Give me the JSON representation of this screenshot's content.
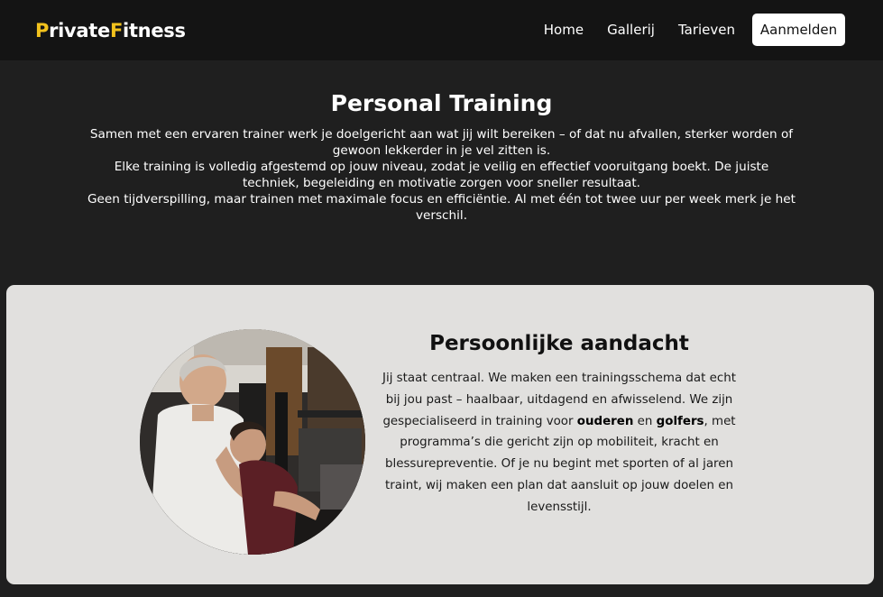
{
  "navbar": {
    "logo": {
      "p": "P",
      "rivate": "rivate",
      "f": "F",
      "itness": "itness"
    },
    "links": [
      "Home",
      "Gallerij",
      "Tarieven"
    ],
    "cta_label": "Aanmelden"
  },
  "intro": {
    "title": "Personal Training",
    "paragraphs": [
      "Samen met een ervaren trainer werk je doelgericht aan wat jij wilt bereiken – of dat nu afvallen, sterker worden of gewoon lekkerder in je vel zitten is.",
      "Elke training is volledig afgestemd op jouw niveau, zodat je veilig en effectief vooruitgang boekt. De juiste techniek, begeleiding en motivatie zorgen voor sneller resultaat.",
      "Geen tijdverspilling, maar trainen met maximale focus en efficiëntie. Al met één tot twee uur per week merk je het verschil."
    ]
  },
  "attention": {
    "title": "Persoonlijke aandacht",
    "body_1": "Jij staat centraal. We maken een trainingsschema dat echt bij jou past – haalbaar, uitdagend en afwisselend. We zijn gespecialiseerd in training voor ",
    "bold_1": "ouderen",
    "body_2": " en ",
    "bold_2": "golfers",
    "body_3": ", met programma’s die gericht zijn op mobiliteit, kracht en blessurepreventie. Of je nu begint met sporten of al jaren traint, wij maken een plan dat aansluit op jouw doelen en levensstijl."
  },
  "colors": {
    "accent": "#f2c21d",
    "page_background": "#1f1f1f",
    "navbar_background": "#141414",
    "card_background": "#e1e0de"
  }
}
